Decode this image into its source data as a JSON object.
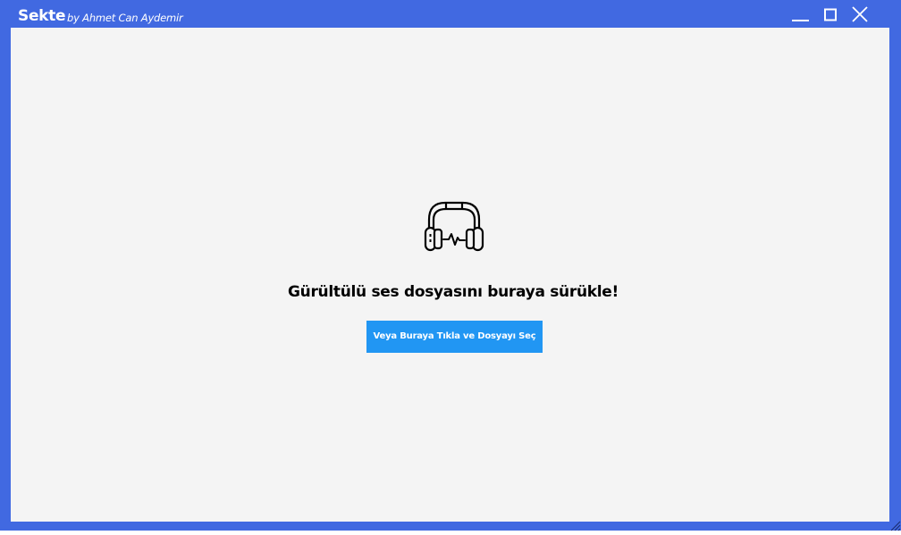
{
  "window": {
    "app_name": "Sekte",
    "author": "by Ahmet Can Aydemir",
    "controls": [
      "minimize-icon",
      "maximize-icon",
      "close-icon"
    ]
  },
  "main": {
    "icon": "headphones-icon",
    "headline": "Gürültülü ses dosyasını buraya sürükle!",
    "select_button_label": "Veya Buraya Tıkla ve Dosyayı Seç"
  },
  "colors": {
    "frame": "#4169e1",
    "content_background": "#f4f4f4",
    "button": "#2196f3",
    "text": "#000000"
  }
}
